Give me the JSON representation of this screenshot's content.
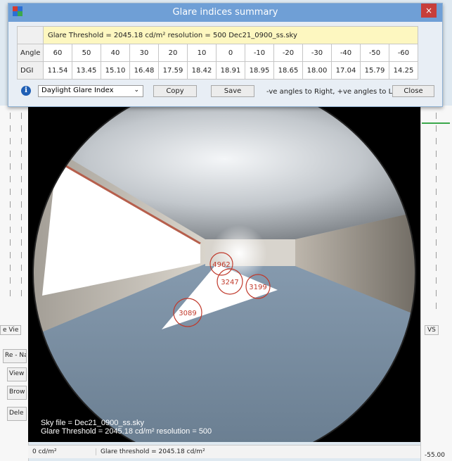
{
  "dialog": {
    "title": "Glare indices summary",
    "close_glyph": "×",
    "info_line": "Glare Threshold = 2045.18 cd/m²    resolution = 500    Dec21_0900_ss.sky",
    "angle_label": "Angle",
    "dgi_label": "DGI",
    "angles": [
      "60",
      "50",
      "40",
      "30",
      "20",
      "10",
      "0",
      "-10",
      "-20",
      "-30",
      "-40",
      "-50",
      "-60"
    ],
    "dgi": [
      "11.54",
      "13.45",
      "15.10",
      "16.48",
      "17.59",
      "18.42",
      "18.91",
      "18.95",
      "18.65",
      "18.00",
      "17.04",
      "15.79",
      "14.25"
    ],
    "index_select": "Daylight Glare Index",
    "copy_label": "Copy",
    "save_label": "Save",
    "note": "-ve angles to Right, +ve angles to Left",
    "close_label": "Close",
    "info_icon": "info-icon"
  },
  "view": {
    "markers": [
      "4962",
      "3247",
      "3199",
      "3089"
    ],
    "sky_file": "Sky file = Dec21_0900_ss.sky",
    "threshold_line": "Glare Threshold = 2045.18 cd/m²  resolution = 500"
  },
  "status": {
    "left": "0 cd/m²",
    "threshold": "Glare threshold = 2045.18 cd/m²",
    "right_value": "-55.00"
  },
  "side": {
    "tab_left": "e  Vie",
    "tab_right": "VS",
    "rename": "Re - Na",
    "view": "View",
    "browse": "Brow",
    "delete": "Dele"
  }
}
